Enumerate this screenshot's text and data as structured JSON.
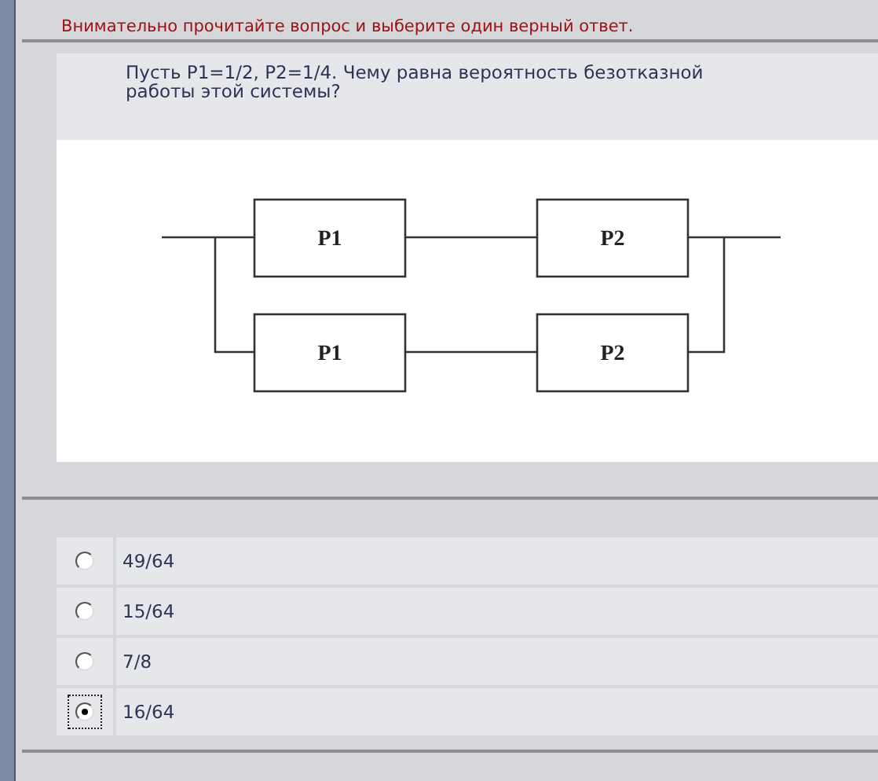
{
  "instruction": "Внимательно прочитайте вопрос и выберите один верный ответ.",
  "question": "Пусть P1=1/2, P2=1/4. Чему равна вероятность безотказной работы этой системы?",
  "diagram": {
    "blocks": [
      {
        "label": "P1"
      },
      {
        "label": "P2"
      },
      {
        "label": "P1"
      },
      {
        "label": "P2"
      }
    ]
  },
  "options": [
    {
      "label": "49/64",
      "selected": false
    },
    {
      "label": "15/64",
      "selected": false
    },
    {
      "label": "7/8",
      "selected": false
    },
    {
      "label": "16/64",
      "selected": true
    }
  ]
}
